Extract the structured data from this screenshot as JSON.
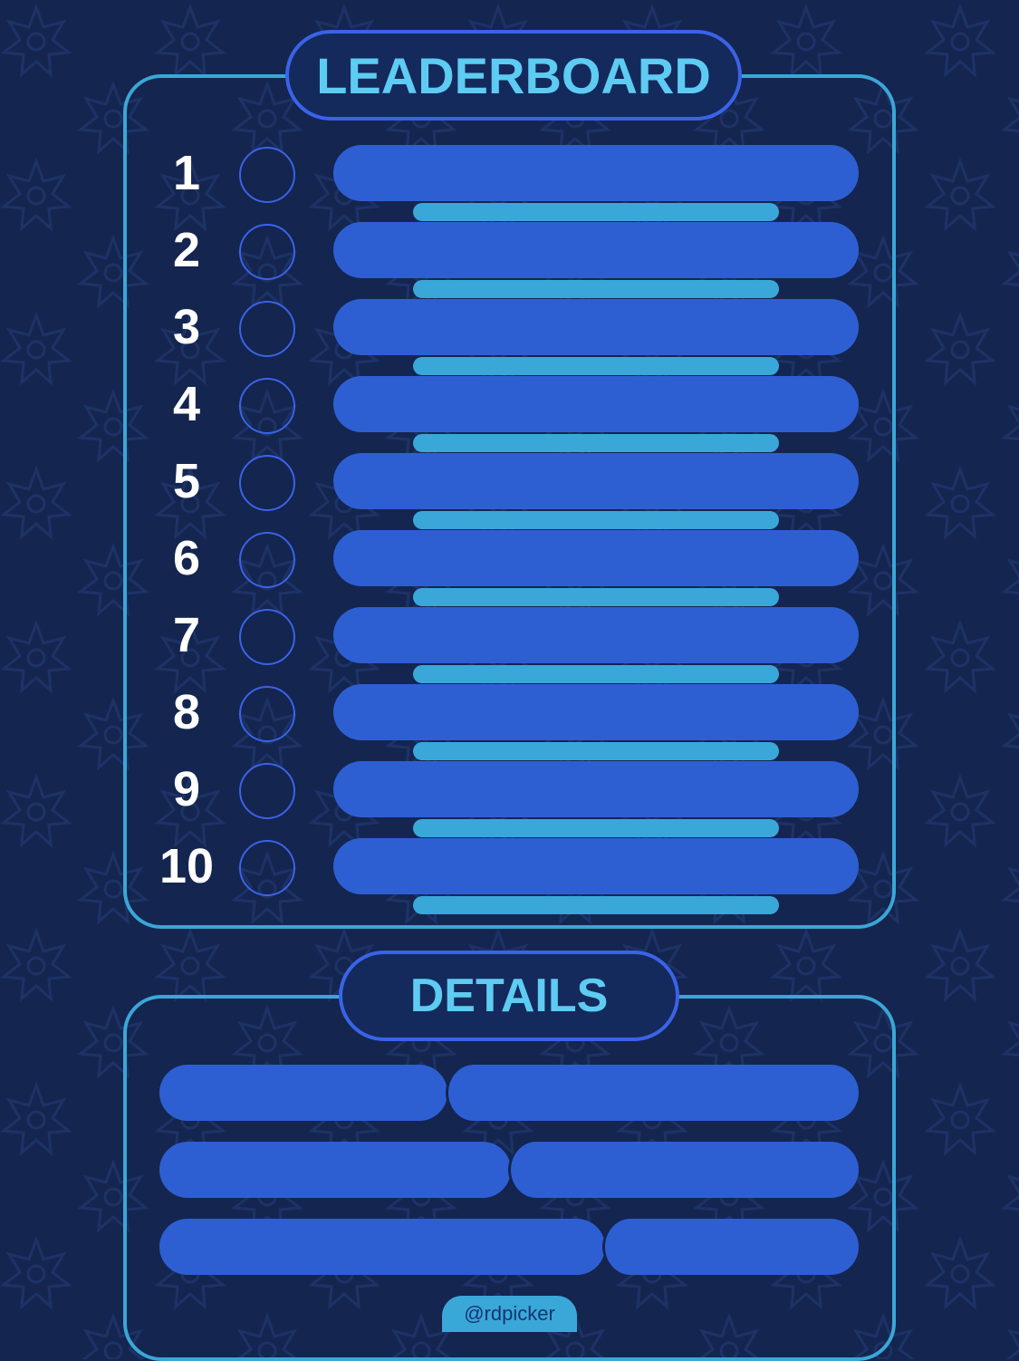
{
  "leaderboard": {
    "title": "LEADERBOARD",
    "ranks": [
      "1",
      "2",
      "3",
      "4",
      "5",
      "6",
      "7",
      "8",
      "9",
      "10"
    ]
  },
  "details": {
    "title": "DETAILS"
  },
  "watermark": "@rdpicker",
  "colors": {
    "background": "#14254f",
    "panel_border": "#3aa7d6",
    "title_border": "#3a63e8",
    "title_text": "#5ecbf2",
    "bar_primary": "#2e5fd2",
    "bar_secondary": "#3aa7d9"
  }
}
